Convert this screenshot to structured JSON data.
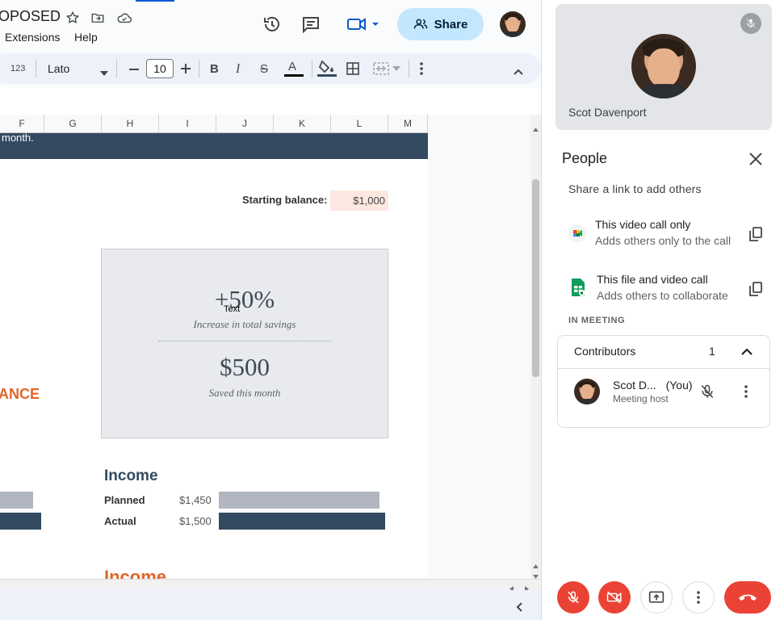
{
  "sheets": {
    "doc_title": "OPOSED",
    "menu": [
      "Extensions",
      "Help"
    ],
    "share_label": "Share",
    "toolbar": {
      "format_123": "123",
      "font": "Lato",
      "font_size": "10"
    },
    "columns": [
      "F",
      "G",
      "H",
      "I",
      "J",
      "K",
      "L",
      "M"
    ],
    "banner_text": "month.",
    "starting_balance_label": "Starting balance:",
    "starting_balance_value": "$1,000",
    "card": {
      "pct": "+50%",
      "cursor_tooltip": "Text",
      "pct_caption": "Increase in total savings",
      "saved": "$500",
      "saved_caption": "Saved this month"
    },
    "left_heading": "ANCE",
    "income": {
      "title": "Income",
      "rows": [
        {
          "label": "Planned",
          "value": "$1,450",
          "color": "#b1b6c1",
          "fraction": 0.967
        },
        {
          "label": "Actual",
          "value": "$1,500",
          "color": "#334a61",
          "fraction": 1.0
        }
      ],
      "title2": "Income"
    },
    "colors": {
      "accent_orange": "#e0662c",
      "navy": "#334a61",
      "share_bg": "#c2e7ff"
    }
  },
  "meet": {
    "self_name": "Scot Davenport",
    "people_title": "People",
    "share_link_label": "Share a link to add others",
    "options": [
      {
        "title": "This video call only",
        "subtitle": "Adds others only to the call"
      },
      {
        "title": "This file and video call",
        "subtitle": "Adds others to collaborate"
      }
    ],
    "in_meeting_label": "IN MEETING",
    "contributors_label": "Contributors",
    "contributors_count": "1",
    "participant": {
      "name": "Scot D...",
      "you": "(You)",
      "role": "Meeting host"
    },
    "colors": {
      "danger": "#ea4335"
    }
  }
}
